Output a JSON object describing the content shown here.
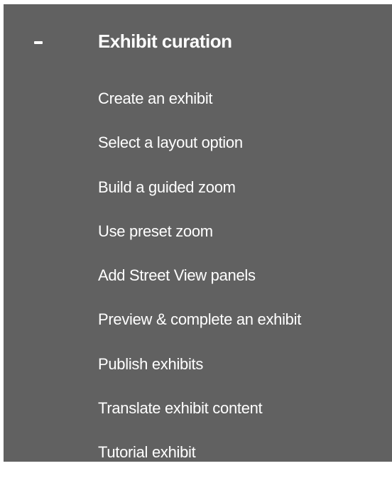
{
  "section": {
    "toggle_symbol": "-",
    "title": "Exhibit curation"
  },
  "menu": {
    "items": [
      {
        "label": "Create an exhibit"
      },
      {
        "label": "Select a layout option"
      },
      {
        "label": "Build a guided zoom"
      },
      {
        "label": "Use preset zoom"
      },
      {
        "label": "Add Street View panels"
      },
      {
        "label": "Preview & complete an exhibit"
      },
      {
        "label": "Publish exhibits"
      },
      {
        "label": "Translate exhibit content"
      },
      {
        "label": "Tutorial exhibit"
      }
    ]
  },
  "colors": {
    "panel_background": "#616161",
    "text": "#ffffff"
  }
}
